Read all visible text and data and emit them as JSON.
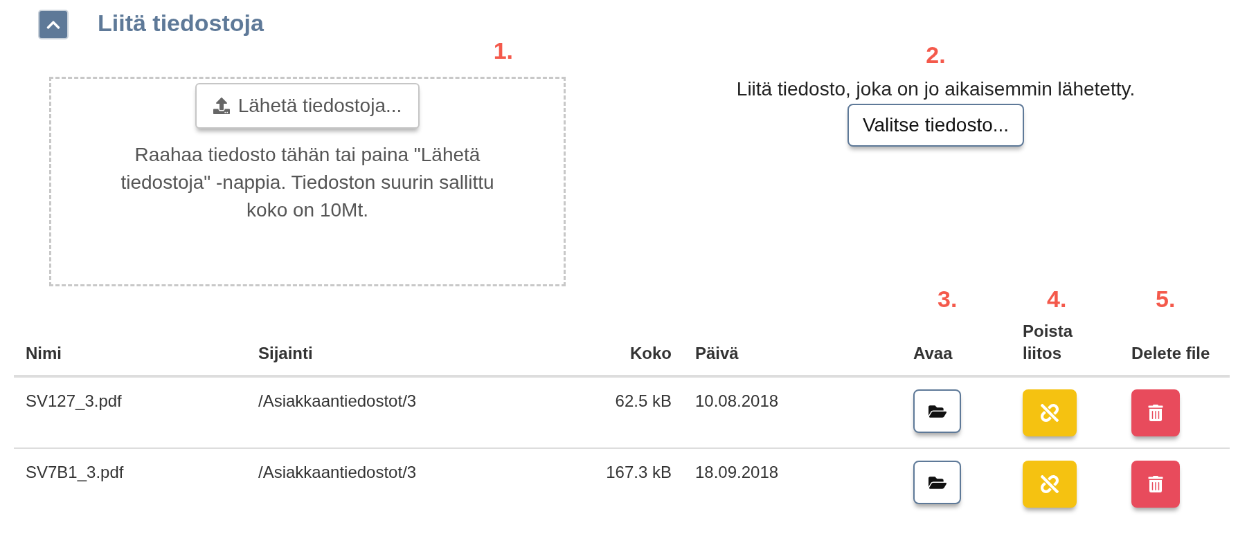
{
  "section": {
    "title": "Liitä tiedostoja",
    "expanded": true
  },
  "upload": {
    "step": "1.",
    "button": "Lähetä tiedostoja...",
    "hint": "Raahaa tiedosto tähän tai paina \"Lähetä tiedostoja\" -nappia. Tiedoston suurin sallittu koko on 10Mt."
  },
  "attach_existing": {
    "step": "2.",
    "text": "Liitä tiedosto, joka on jo aikaisemmin lähetetty.",
    "button": "Valitse tiedosto..."
  },
  "table": {
    "columns": [
      {
        "label": "Nimi",
        "kind": "text"
      },
      {
        "label": "Sijainti",
        "kind": "text"
      },
      {
        "label": "Koko",
        "kind": "number"
      },
      {
        "label": "Päivä",
        "kind": "text"
      },
      {
        "label": "Avaa",
        "kind": "open",
        "step": "3."
      },
      {
        "label": "Poista liitos",
        "kind": "unlink",
        "step": "4."
      },
      {
        "label": "Delete file",
        "kind": "delete",
        "step": "5."
      }
    ],
    "rows": [
      {
        "cells": [
          "SV127_3.pdf",
          "/Asiakkaantiedostot/3",
          "62.5 kB",
          "10.08.2018"
        ]
      },
      {
        "cells": [
          "SV7B1_3.pdf",
          "/Asiakkaantiedostot/3",
          "167.3 kB",
          "18.09.2018"
        ]
      }
    ]
  }
}
